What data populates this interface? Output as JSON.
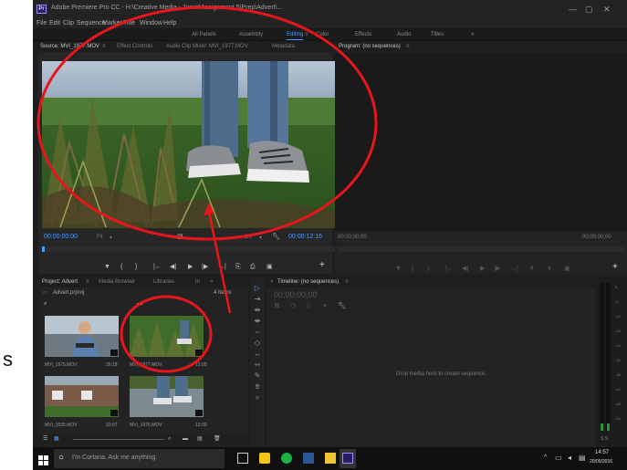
{
  "window": {
    "title": "Adobe Premiere Pro CC - H:\\Creative Media - Jasvir\\Assignment 5\\Prep\\Advert\\..."
  },
  "menu": [
    "File",
    "Edit",
    "Clip",
    "Sequence",
    "Marker",
    "Title",
    "Window",
    "Help"
  ],
  "workspaces": {
    "items": [
      "All Panels",
      "Assembly",
      "Editing",
      "Color",
      "Effects",
      "Audio",
      "Titles"
    ],
    "active": "Editing",
    "more": "»"
  },
  "source_monitor": {
    "tabs": [
      "Source: MVI_1977.MOV",
      "Effect Controls",
      "Audio Clip Mixer: MVI_1977.MOV",
      "Metadata"
    ],
    "timecode_in": "00:00:00:00",
    "fit": "Fit",
    "resolution": "1/2",
    "duration": "00:00:12:16"
  },
  "program_monitor": {
    "tab": "Program: (no sequences)",
    "timecode_in": "00;00;00;00",
    "timecode_out": "00;00;00;00"
  },
  "project": {
    "tabs": [
      "Project: Advert",
      "Media Browser",
      "Libraries",
      "In"
    ],
    "file": "Advert.prproj",
    "item_count": "4 Items",
    "clips": [
      {
        "name": "MVI_1975.MOV",
        "duration": "35:18"
      },
      {
        "name": "MVI_1977.MOV",
        "duration": "12:09"
      },
      {
        "name": "MVI_1935.MOV",
        "duration": "32:07"
      },
      {
        "name": "MVI_1976.MOV",
        "duration": "12:09"
      }
    ]
  },
  "timeline": {
    "tab": "Timeline: (no sequences)",
    "timecode": "00;00;00;00",
    "drop_message": "Drop media here to create sequence."
  },
  "audio_meter": {
    "labels": [
      "0",
      "-6",
      "-12",
      "-18",
      "-24",
      "-30",
      "-36",
      "-42",
      "-48",
      "-54"
    ],
    "footer": "S S"
  },
  "taskbar": {
    "search_placeholder": "I'm Cortana. Ask me anything.",
    "time": "14:57",
    "date": "20/09/2016"
  },
  "annotation": {
    "side_letter": "s",
    "color": "#e8161c"
  }
}
